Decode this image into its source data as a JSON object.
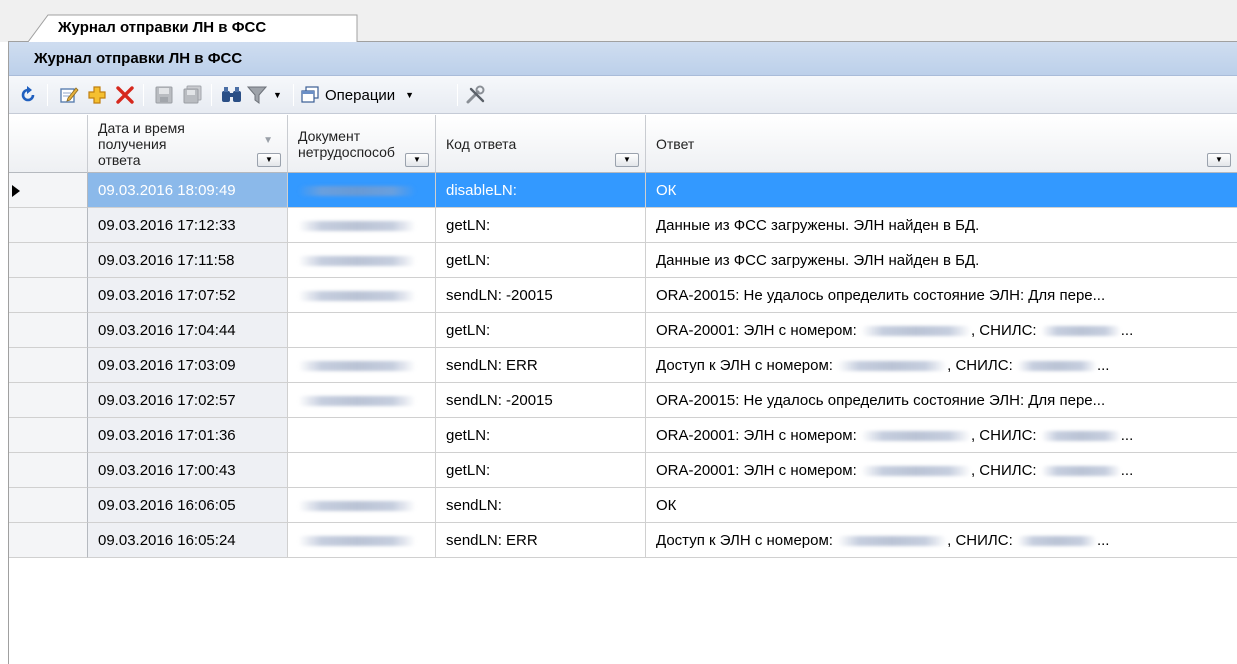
{
  "tab": {
    "label": "Журнал отправки ЛН в ФСС"
  },
  "panel": {
    "title": "Журнал отправки ЛН в ФСС"
  },
  "toolbar": {
    "operations_label": "Операции",
    "icons": [
      "refresh-icon",
      "edit-icon",
      "add-icon",
      "delete-icon",
      "save-icon",
      "save-all-icon",
      "find-icon",
      "filter-icon",
      "operations-icon",
      "settings-icon"
    ],
    "colors": {
      "add": "#e8a317",
      "delete": "#d6281d",
      "refresh": "#1f5fbf"
    }
  },
  "grid": {
    "columns": [
      {
        "key": "dt",
        "label": "Дата и время\nполучения\nответа"
      },
      {
        "key": "doc",
        "label": "Документ\nнетрудоспособ"
      },
      {
        "key": "code",
        "label": "Код ответа"
      },
      {
        "key": "answer",
        "label": "Ответ"
      }
    ],
    "rows": [
      {
        "dt": "09.03.2016 18:09:49",
        "code": "disableLN:",
        "answer": [
          {
            "t": "ОК"
          }
        ],
        "doc_blurred": true,
        "selected": true
      },
      {
        "dt": "09.03.2016 17:12:33",
        "code": "getLN:",
        "answer": [
          {
            "t": "Данные из ФСС загружены. ЭЛН найден в БД."
          }
        ],
        "doc_blurred": true
      },
      {
        "dt": "09.03.2016 17:11:58",
        "code": "getLN:",
        "answer": [
          {
            "t": "Данные из ФСС загружены. ЭЛН найден в БД."
          }
        ],
        "doc_blurred": true
      },
      {
        "dt": "09.03.2016 17:07:52",
        "code": "sendLN: -20015",
        "answer": [
          {
            "t": "ORA-20015: Не удалось определить состояние ЭЛН: Для пере..."
          }
        ],
        "doc_blurred": true
      },
      {
        "dt": "09.03.2016 17:04:44",
        "code": "getLN:",
        "answer": [
          {
            "t": "ORA-20001: ЭЛН с номером: "
          },
          {
            "blur": 110
          },
          {
            "t": ", СНИЛС: "
          },
          {
            "blur": 80
          },
          {
            "t": "..."
          }
        ],
        "doc_blurred": false
      },
      {
        "dt": "09.03.2016 17:03:09",
        "code": "sendLN: ERR",
        "answer": [
          {
            "t": "Доступ к ЭЛН с номером: "
          },
          {
            "blur": 110
          },
          {
            "t": ", СНИЛС: "
          },
          {
            "blur": 80
          },
          {
            "t": "..."
          }
        ],
        "doc_blurred": true
      },
      {
        "dt": "09.03.2016 17:02:57",
        "code": "sendLN: -20015",
        "answer": [
          {
            "t": "ORA-20015: Не удалось определить состояние ЭЛН: Для пере..."
          }
        ],
        "doc_blurred": true
      },
      {
        "dt": "09.03.2016 17:01:36",
        "code": "getLN:",
        "answer": [
          {
            "t": "ORA-20001: ЭЛН с номером: "
          },
          {
            "blur": 110
          },
          {
            "t": ", СНИЛС: "
          },
          {
            "blur": 80
          },
          {
            "t": "..."
          }
        ],
        "doc_blurred": false
      },
      {
        "dt": "09.03.2016 17:00:43",
        "code": "getLN:",
        "answer": [
          {
            "t": "ORA-20001: ЭЛН с номером: "
          },
          {
            "blur": 110
          },
          {
            "t": ", СНИЛС: "
          },
          {
            "blur": 80
          },
          {
            "t": "..."
          }
        ],
        "doc_blurred": false
      },
      {
        "dt": "09.03.2016 16:06:05",
        "code": "sendLN:",
        "answer": [
          {
            "t": "ОК"
          }
        ],
        "doc_blurred": true
      },
      {
        "dt": "09.03.2016 16:05:24",
        "code": "sendLN: ERR",
        "answer": [
          {
            "t": "Доступ к ЭЛН с номером: "
          },
          {
            "blur": 110
          },
          {
            "t": ", СНИЛС: "
          },
          {
            "blur": 80
          },
          {
            "t": "..."
          }
        ],
        "doc_blurred": true
      }
    ]
  }
}
